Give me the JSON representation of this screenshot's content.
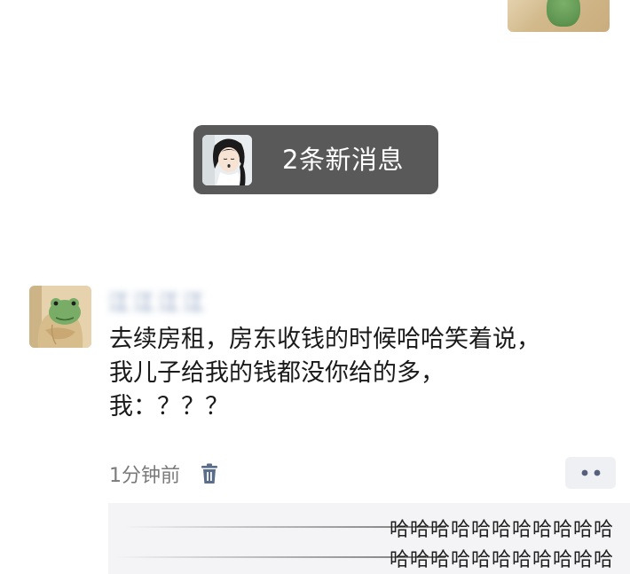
{
  "new_messages": {
    "label": "2条新消息"
  },
  "message": {
    "sender": "江江江江",
    "lines": [
      "去续房租，房东收钱的时候哈哈笑着说，",
      "我儿子给我的钱都没你给的多，",
      "我：？？？"
    ],
    "time": "1分钟前"
  },
  "comment": {
    "lines": [
      "哈哈哈哈哈哈哈哈哈哈哈",
      "哈哈哈哈哈哈哈哈哈哈哈"
    ]
  },
  "icons": {
    "trash": "trash-icon",
    "more": "more-dots-icon"
  },
  "colors": {
    "pill_bg": "#595959",
    "sender_name": "#4a6a9a",
    "time_text": "#7a7a7a",
    "comment_bg": "#f4f4f6"
  }
}
